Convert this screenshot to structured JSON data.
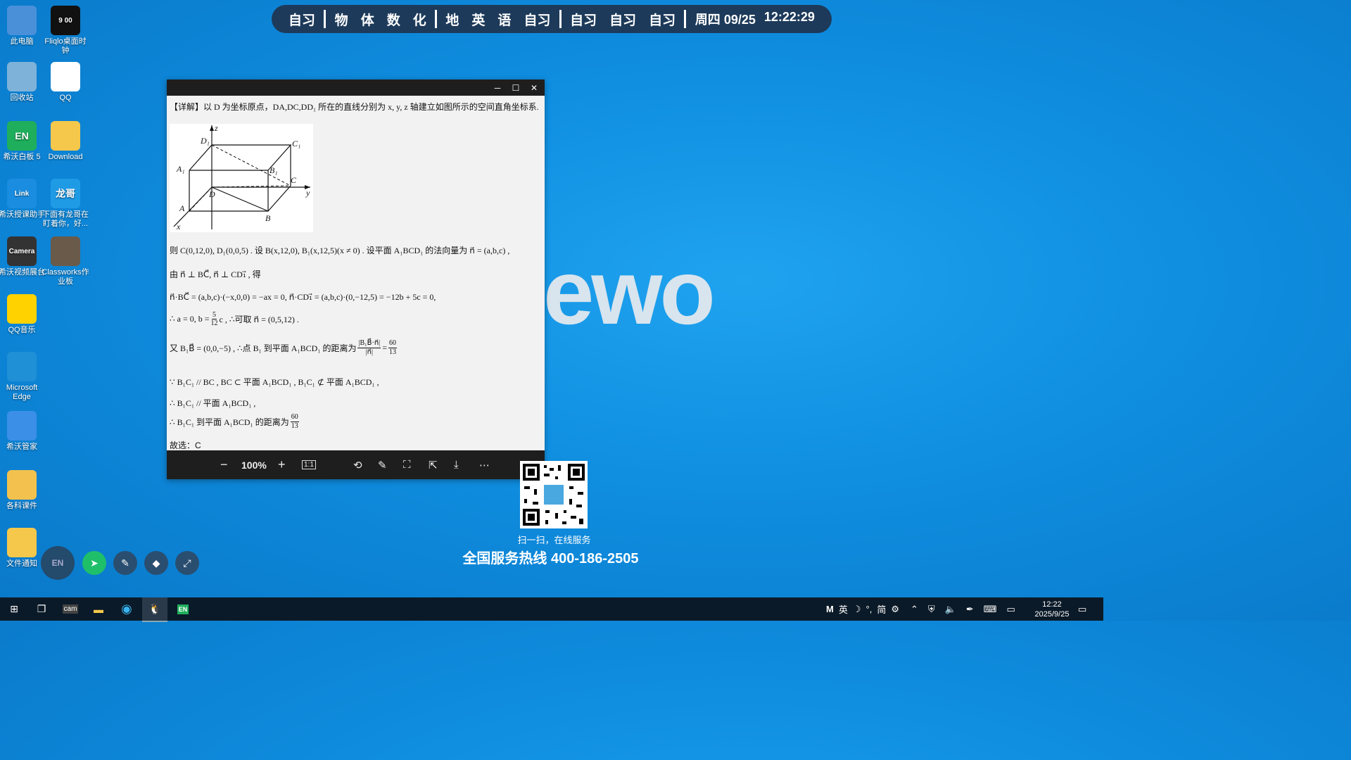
{
  "desktop_icons": [
    {
      "label": "此电脑",
      "icon": "computer-icon",
      "color": "#4a90d9"
    },
    {
      "label": "Fliqlo桌面时钟",
      "icon": "flip-clock-icon",
      "color": "#111111",
      "badge": "9 00"
    },
    {
      "label": "回收站",
      "icon": "recycle-bin-icon",
      "color": "#7fb2d9"
    },
    {
      "label": "QQ",
      "icon": "qq-penguin-icon",
      "color": "#ffffff"
    },
    {
      "label": "希沃白板 5",
      "icon": "en-whiteboard-icon",
      "color": "#1fae5c",
      "badge": "EN"
    },
    {
      "label": "Download",
      "icon": "folder-icon",
      "color": "#f5c84c"
    },
    {
      "label": "希沃授课助手",
      "icon": "link-icon",
      "color": "#1b8de0",
      "badge": "Link"
    },
    {
      "label": "下面有龙哥在盯着你，好...",
      "icon": "peek-icon",
      "color": "#1f9be6",
      "badge": "龙哥"
    },
    {
      "label": "希沃视频展台",
      "icon": "camera-icon",
      "color": "#333333",
      "badge": "Camera"
    },
    {
      "label": "Classworks作业板",
      "icon": "portrait-icon",
      "color": "#6a5a4a"
    },
    {
      "label": "QQ音乐",
      "icon": "qq-music-icon",
      "color": "#ffd200"
    },
    {
      "label": "Microsoft Edge",
      "icon": "edge-icon",
      "color": "#1f8fd6"
    },
    {
      "label": "希沃管家",
      "icon": "shield-icon",
      "color": "#3b8fe6"
    },
    {
      "label": "各科课件",
      "icon": "folder-files-icon",
      "color": "#f2c14e"
    },
    {
      "label": "文件通知",
      "icon": "warning-folder-icon",
      "color": "#f5c84c"
    }
  ],
  "schedule": {
    "groups": [
      [
        "自习"
      ],
      [
        "物",
        "体",
        "数",
        "化"
      ],
      [
        "地",
        "英",
        "语",
        "自习"
      ],
      [
        "自习",
        "自习",
        "自习"
      ]
    ],
    "day": "周四 09/25",
    "time": "12:22:29"
  },
  "watermark": "ewo",
  "viewer": {
    "controls": {
      "minimize": "─",
      "maximize": "☐",
      "close": "✕"
    },
    "content": {
      "line1": "【详解】以 D 为坐标原点，DA,DC,DD₁ 所在的直线分别为 x, y, z 轴建立如图所示的空间直角坐标系.",
      "line2": "则 C(0,12,0), D₁(0,0,5) . 设 B(x,12,0), B₁(x,12,5)(x ≠ 0) . 设平面 A₁BCD₁ 的法向量为 n⃗ = (a,b,c) ,",
      "line3": "由 n⃗ ⊥ BC⃗, n⃗ ⊥ CD₁⃗ , 得",
      "line4": "n⃗·BC⃗ = (a,b,c)·(−x,0,0) = −ax = 0, n⃗·CD₁⃗ = (a,b,c)·(0,−12,5) = −12b + 5c = 0,",
      "line5a": "∴ a = 0, b = ",
      "line5num": "5",
      "line5den": "12",
      "line5b": " c , ∴可取 n⃗ = (0,5,12) .",
      "line6a": "又 B₁B⃗ = (0,0,−5) , ∴点 B₁ 到平面 A₁BCD₁ 的距离为 ",
      "line6num": "|B₁B⃗·n⃗|",
      "line6den": "|n⃗|",
      "line6b": " = ",
      "line6num2": "60",
      "line6den2": "13",
      "line7": "∵ B₁C₁ // BC , BC ⊂ 平面 A₁BCD₁ , B₁C₁ ⊄ 平面 A₁BCD₁ ,",
      "line8": "∴ B₁C₁ // 平面 A₁BCD₁ ,",
      "line9a": "∴ B₁C₁ 到平面 A₁BCD₁ 的距离为 ",
      "line9num": "60",
      "line9den": "13",
      "line10": "故选：C",
      "figure_labels": {
        "z": "z",
        "y": "y",
        "x": "x",
        "D1": "D₁",
        "C1": "C₁",
        "A1": "A₁",
        "B1": "B₁",
        "C": "C",
        "D": "D",
        "A": "A",
        "B": "B"
      }
    },
    "toolbar": {
      "zoom_out": "−",
      "zoom_level": "100%",
      "zoom_in": "+",
      "actual_size": "1:1"
    }
  },
  "qr_caption": "扫一扫，在线服务",
  "hotline": "全国服务热线 400-186-2505",
  "taskbar": {
    "ime": [
      "M",
      "英",
      "☽",
      "°,",
      "简",
      "⚙"
    ],
    "time": "12:22",
    "date": "2025/9/25"
  }
}
